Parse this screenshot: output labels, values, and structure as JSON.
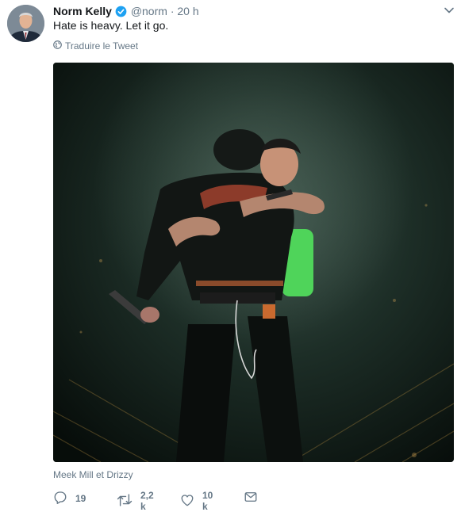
{
  "tweet": {
    "author_name": "Norm Kelly",
    "handle": "@norm",
    "separator": "·",
    "time": "20 h",
    "text": "Hate is heavy. Let it go.",
    "translate_label": "Traduire le Tweet",
    "photo_caption": "Meek Mill et Drizzy"
  },
  "actions": {
    "reply_count": "19",
    "retweet_count": "2,2 k",
    "like_count": "10 k"
  },
  "colors": {
    "verified": "#1da1f2",
    "secondary_text": "#657786",
    "photo_background": "#0e1a14"
  },
  "icons": [
    "verified-badge-icon",
    "chevron-down-icon",
    "globe-icon",
    "reply-icon",
    "retweet-icon",
    "like-icon",
    "direct-message-icon"
  ]
}
